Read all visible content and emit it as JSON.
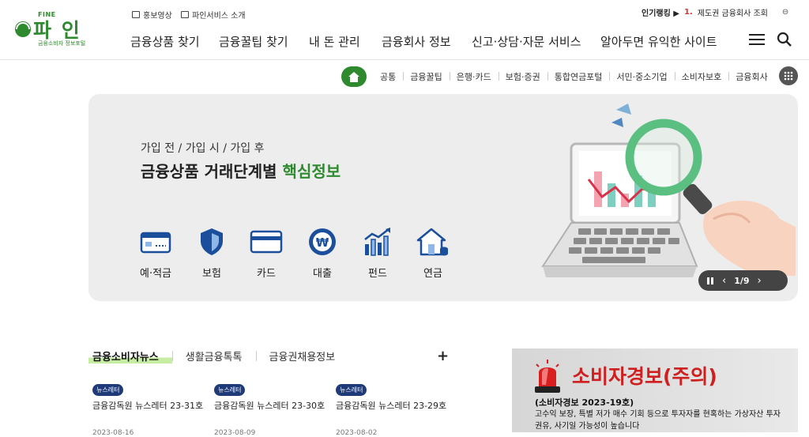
{
  "header": {
    "logo": {
      "fine": "FINE",
      "text": "파 인",
      "sub": "금융소비자 정보포털"
    },
    "util_links": [
      "홍보영상",
      "파인서비스 소개"
    ],
    "nav": [
      "금융상품 찾기",
      "금융꿀팁 찾기",
      "내 돈 관리",
      "금융회사 정보",
      "신고·상담·자문 서비스",
      "알아두면 유익한 사이트"
    ],
    "ranking": {
      "label": "인기랭킹 ▶",
      "num": "1.",
      "item": "제도권 금융회사 조회",
      "toggle": "⊖"
    }
  },
  "categories": [
    "공통",
    "금융꿀팁",
    "은행·카드",
    "보험·증권",
    "통합연금포털",
    "서민·중소기업",
    "소비자보호",
    "금융회사"
  ],
  "banner": {
    "kicker": "가입 전 / 가입 시 / 가입 후",
    "title_main": "금융상품 거래단계별",
    "title_highlight": "핵심정보",
    "products": [
      "예·적금",
      "보험",
      "카드",
      "대출",
      "펀드",
      "연금"
    ],
    "slider": {
      "current": "1",
      "total": "9",
      "separator": "/"
    }
  },
  "news": {
    "tabs": [
      "금융소비자뉴스",
      "생활금융톡톡",
      "금융권채용정보"
    ],
    "more": "+",
    "items": [
      {
        "badge": "뉴스레터",
        "title": "금융감독원 뉴스레터 23-31호",
        "date": "2023-08-16"
      },
      {
        "badge": "뉴스레터",
        "title": "금융감독원 뉴스레터 23-30호",
        "date": "2023-08-09"
      },
      {
        "badge": "뉴스레터",
        "title": "금융감독원 뉴스레터 23-29호",
        "date": "2023-08-02"
      }
    ]
  },
  "alert": {
    "title": "소비자경보(주의)",
    "subtitle": "(소비자경보 2023-19호)",
    "body": "고수익 보장, 특별 저가 매수 기회 등으로 투자자를 현혹하는 가상자산 투자권유, 사기일 가능성이 높습니다"
  },
  "colors": {
    "brand_green": "#2f8a2f",
    "alert_red": "#d01f1f",
    "badge_navy": "#1f3a78",
    "icon_blue": "#1b4f9c"
  }
}
